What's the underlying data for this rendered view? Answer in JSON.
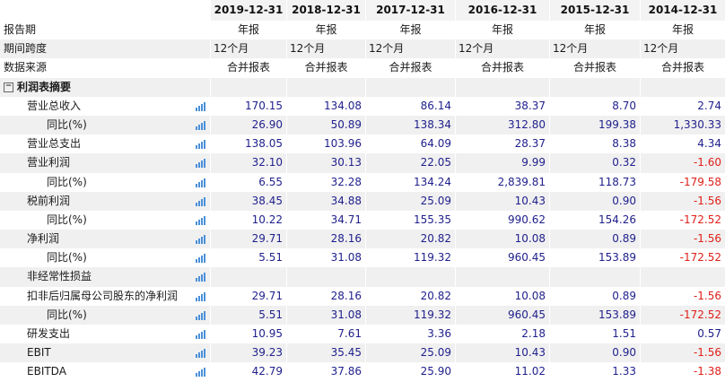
{
  "header": {
    "years": [
      "2019-12-31",
      "2018-12-31",
      "2017-12-31",
      "2016-12-31",
      "2015-12-31",
      "2014-12-31"
    ]
  },
  "meta_rows": [
    {
      "label": "报告期",
      "values": [
        "年报",
        "年报",
        "年报",
        "年报",
        "年报",
        "年报"
      ],
      "align": "ctr"
    },
    {
      "label": "期间跨度",
      "values": [
        "12个月",
        "12个月",
        "12个月",
        "12个月",
        "12个月",
        "12个月"
      ],
      "align": "lft"
    },
    {
      "label": "数据来源",
      "values": [
        "合并报表",
        "合并报表",
        "合并报表",
        "合并报表",
        "合并报表",
        "合并报表"
      ],
      "align": "ctr"
    }
  ],
  "section": {
    "toggle": "⊟",
    "label": "利润表摘要"
  },
  "rows": [
    {
      "label": "营业总收入",
      "indent": 1,
      "chart": true,
      "values": [
        "170.15",
        "134.08",
        "86.14",
        "38.37",
        "8.70",
        "2.74"
      ]
    },
    {
      "label": "同比(%)",
      "indent": 2,
      "chart": true,
      "values": [
        "26.90",
        "50.89",
        "138.34",
        "312.80",
        "199.38",
        "1,330.33"
      ]
    },
    {
      "label": "营业总支出",
      "indent": 1,
      "chart": true,
      "values": [
        "138.05",
        "103.96",
        "64.09",
        "28.37",
        "8.38",
        "4.34"
      ]
    },
    {
      "label": "营业利润",
      "indent": 1,
      "chart": true,
      "values": [
        "32.10",
        "30.13",
        "22.05",
        "9.99",
        "0.32",
        "-1.60"
      ]
    },
    {
      "label": "同比(%)",
      "indent": 2,
      "chart": true,
      "values": [
        "6.55",
        "32.28",
        "134.24",
        "2,839.81",
        "118.73",
        "-179.58"
      ]
    },
    {
      "label": "税前利润",
      "indent": 1,
      "chart": true,
      "values": [
        "38.45",
        "34.88",
        "25.09",
        "10.43",
        "0.90",
        "-1.56"
      ]
    },
    {
      "label": "同比(%)",
      "indent": 2,
      "chart": true,
      "values": [
        "10.22",
        "34.71",
        "155.35",
        "990.62",
        "154.26",
        "-172.52"
      ]
    },
    {
      "label": "净利润",
      "indent": 1,
      "chart": true,
      "values": [
        "29.71",
        "28.16",
        "20.82",
        "10.08",
        "0.89",
        "-1.56"
      ]
    },
    {
      "label": "同比(%)",
      "indent": 2,
      "chart": true,
      "values": [
        "5.51",
        "31.08",
        "119.32",
        "960.45",
        "153.89",
        "-172.52"
      ]
    },
    {
      "label": "非经常性损益",
      "indent": 1,
      "chart": true,
      "values": [
        "",
        "",
        "",
        "",
        "",
        ""
      ]
    },
    {
      "label": "扣非后归属母公司股东的净利润",
      "indent": 1,
      "chart": true,
      "values": [
        "29.71",
        "28.16",
        "20.82",
        "10.08",
        "0.89",
        "-1.56"
      ]
    },
    {
      "label": "同比(%)",
      "indent": 2,
      "chart": true,
      "values": [
        "5.51",
        "31.08",
        "119.32",
        "960.45",
        "153.89",
        "-172.52"
      ]
    },
    {
      "label": "研发支出",
      "indent": 1,
      "chart": true,
      "values": [
        "10.95",
        "7.61",
        "3.36",
        "2.18",
        "1.51",
        "0.57"
      ]
    },
    {
      "label": "EBIT",
      "indent": 1,
      "chart": true,
      "values": [
        "39.23",
        "35.45",
        "25.09",
        "10.43",
        "0.90",
        "-1.56"
      ]
    },
    {
      "label": "EBITDA",
      "indent": 1,
      "chart": true,
      "values": [
        "42.79",
        "37.86",
        "25.90",
        "11.02",
        "1.33",
        "-1.38"
      ]
    }
  ],
  "colors": {
    "value": "#1f1f8c",
    "negative": "#e0201a",
    "header_bg": "#f3f3f3",
    "alt_bg": "#f0f0f0",
    "chart_icon": "#4a90d9"
  },
  "icons": {
    "chart": "bar-chart-icon",
    "toggle": "collapse-icon"
  }
}
